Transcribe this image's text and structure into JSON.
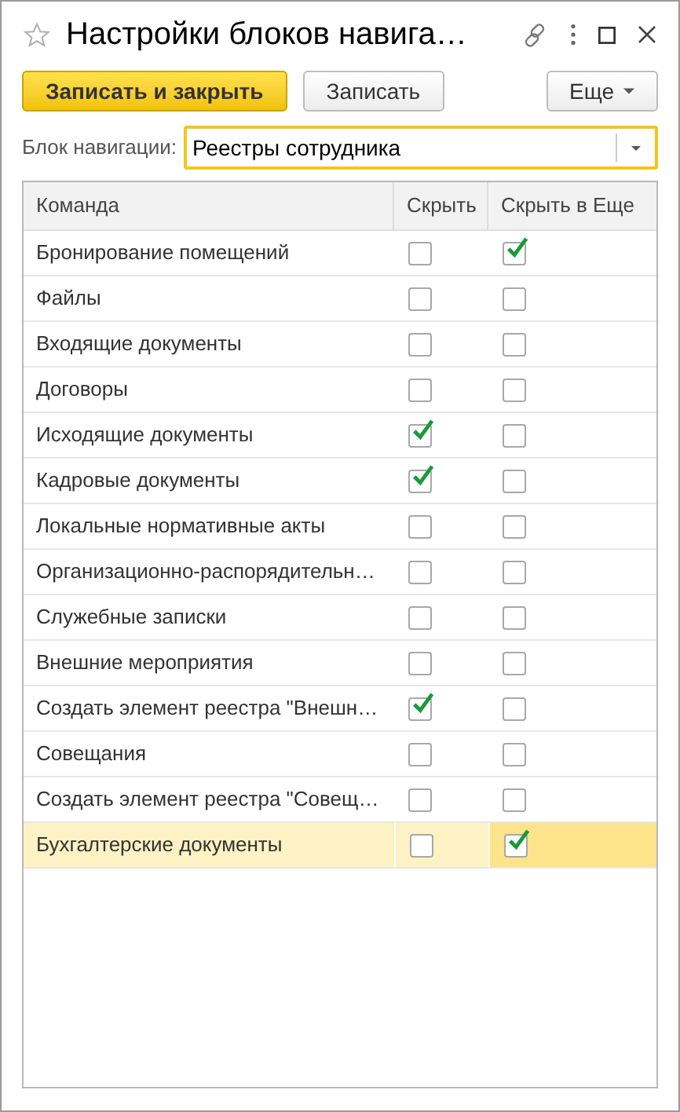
{
  "window": {
    "title": "Настройки блоков навига…",
    "favorite": false
  },
  "toolbar": {
    "buttons": [
      {
        "label": "Записать и закрыть",
        "kind": "primary"
      },
      {
        "label": "Записать",
        "kind": "normal"
      },
      {
        "label": "Еще",
        "kind": "menu"
      }
    ]
  },
  "field": {
    "label": "Блок навигации:",
    "value": "Реестры сотрудника",
    "focused": true
  },
  "table": {
    "columns": [
      "Команда",
      "Скрыть",
      "Скрыть в Еще"
    ],
    "rows": [
      {
        "command": "Бронирование помещений",
        "selected": false,
        "hide": {
          "checked": false,
          "focused": false
        },
        "hide_in_more": {
          "checked": true,
          "focused": false
        }
      },
      {
        "command": "Файлы",
        "selected": false,
        "hide": {
          "checked": false,
          "focused": false
        },
        "hide_in_more": {
          "checked": false,
          "focused": false
        }
      },
      {
        "command": "Входящие документы",
        "selected": false,
        "hide": {
          "checked": false,
          "focused": false
        },
        "hide_in_more": {
          "checked": false,
          "focused": false
        }
      },
      {
        "command": "Договоры",
        "selected": false,
        "hide": {
          "checked": false,
          "focused": false
        },
        "hide_in_more": {
          "checked": false,
          "focused": false
        }
      },
      {
        "command": "Исходящие документы",
        "selected": false,
        "hide": {
          "checked": true,
          "focused": false
        },
        "hide_in_more": {
          "checked": false,
          "focused": false
        }
      },
      {
        "command": "Кадровые документы",
        "selected": false,
        "hide": {
          "checked": true,
          "focused": false
        },
        "hide_in_more": {
          "checked": false,
          "focused": false
        }
      },
      {
        "command": "Локальные нормативные акты",
        "selected": false,
        "hide": {
          "checked": false,
          "focused": false
        },
        "hide_in_more": {
          "checked": false,
          "focused": false
        }
      },
      {
        "command": "Организационно-распорядительн…",
        "selected": false,
        "hide": {
          "checked": false,
          "focused": false
        },
        "hide_in_more": {
          "checked": false,
          "focused": false
        }
      },
      {
        "command": "Служебные записки",
        "selected": false,
        "hide": {
          "checked": false,
          "focused": false
        },
        "hide_in_more": {
          "checked": false,
          "focused": false
        }
      },
      {
        "command": "Внешние мероприятия",
        "selected": false,
        "hide": {
          "checked": false,
          "focused": false
        },
        "hide_in_more": {
          "checked": false,
          "focused": false
        }
      },
      {
        "command": "Создать элемент реестра \"Внешн…",
        "selected": false,
        "hide": {
          "checked": true,
          "focused": false
        },
        "hide_in_more": {
          "checked": false,
          "focused": false
        }
      },
      {
        "command": "Совещания",
        "selected": false,
        "hide": {
          "checked": false,
          "focused": false
        },
        "hide_in_more": {
          "checked": false,
          "focused": false
        }
      },
      {
        "command": "Создать элемент реестра \"Совещ…",
        "selected": false,
        "hide": {
          "checked": false,
          "focused": false
        },
        "hide_in_more": {
          "checked": false,
          "focused": false
        }
      },
      {
        "command": "Бухгалтерские документы",
        "selected": true,
        "hide": {
          "checked": false,
          "focused": false
        },
        "hide_in_more": {
          "checked": true,
          "focused": true
        }
      }
    ]
  }
}
